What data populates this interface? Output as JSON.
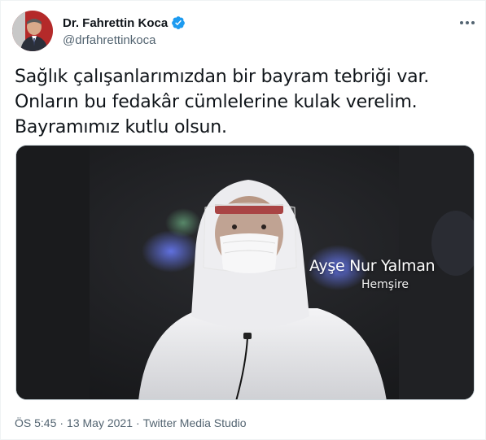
{
  "author": {
    "display_name": "Dr. Fahrettin Koca",
    "handle": "@drfahrettinkoca",
    "verified": true
  },
  "icons": {
    "more": "more-icon",
    "verified": "verified-badge-icon",
    "avatar": "avatar"
  },
  "tweet": {
    "text": "Sağlık çalışanlarımızdan bir bayram tebriği var. Onların bu fedakâr cümlelerine kulak verelim. Bayramımız kutlu olsun."
  },
  "video": {
    "caption_name": "Ayşe Nur Yalman",
    "caption_role": "Hemşire"
  },
  "meta": {
    "time": "ÖS 5:45",
    "separator_1": "·",
    "date": "13 May 2021",
    "separator_2": "·",
    "source": "Twitter Media Studio"
  },
  "colors": {
    "verified": "#1d9bf0",
    "secondary_text": "#536471",
    "primary_text": "#0f1419"
  }
}
